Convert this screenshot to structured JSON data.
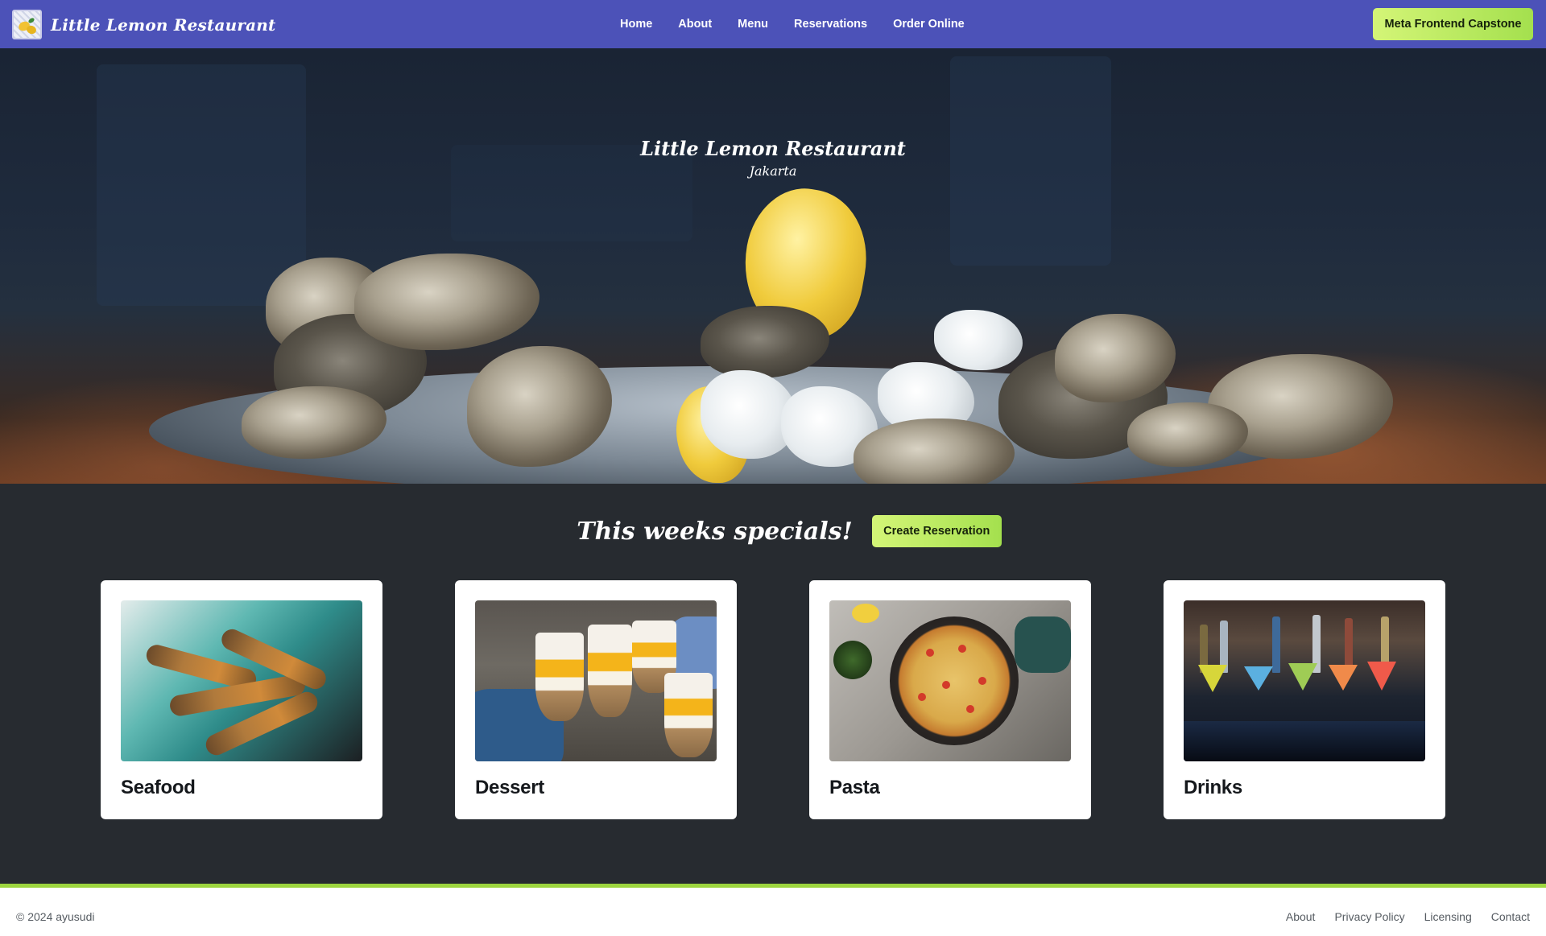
{
  "navbar": {
    "brand": "Little Lemon Restaurant",
    "links": [
      "Home",
      "About",
      "Menu",
      "Reservations",
      "Order Online"
    ],
    "cta": "Meta Frontend Capstone"
  },
  "hero": {
    "title": "Little Lemon Restaurant",
    "subtitle": "Jakarta"
  },
  "specials": {
    "title": "This weeks specials!",
    "button": "Create Reservation",
    "cards": [
      {
        "title": "Seafood"
      },
      {
        "title": "Dessert"
      },
      {
        "title": "Pasta"
      },
      {
        "title": "Drinks"
      }
    ]
  },
  "footer": {
    "copyright": "© 2024 ayusudi",
    "links": [
      "About",
      "Privacy Policy",
      "Licensing",
      "Contact"
    ]
  },
  "colors": {
    "navbar": "#4c52b8",
    "accent_green": "#a4e04e",
    "page_bg": "#272b30"
  }
}
